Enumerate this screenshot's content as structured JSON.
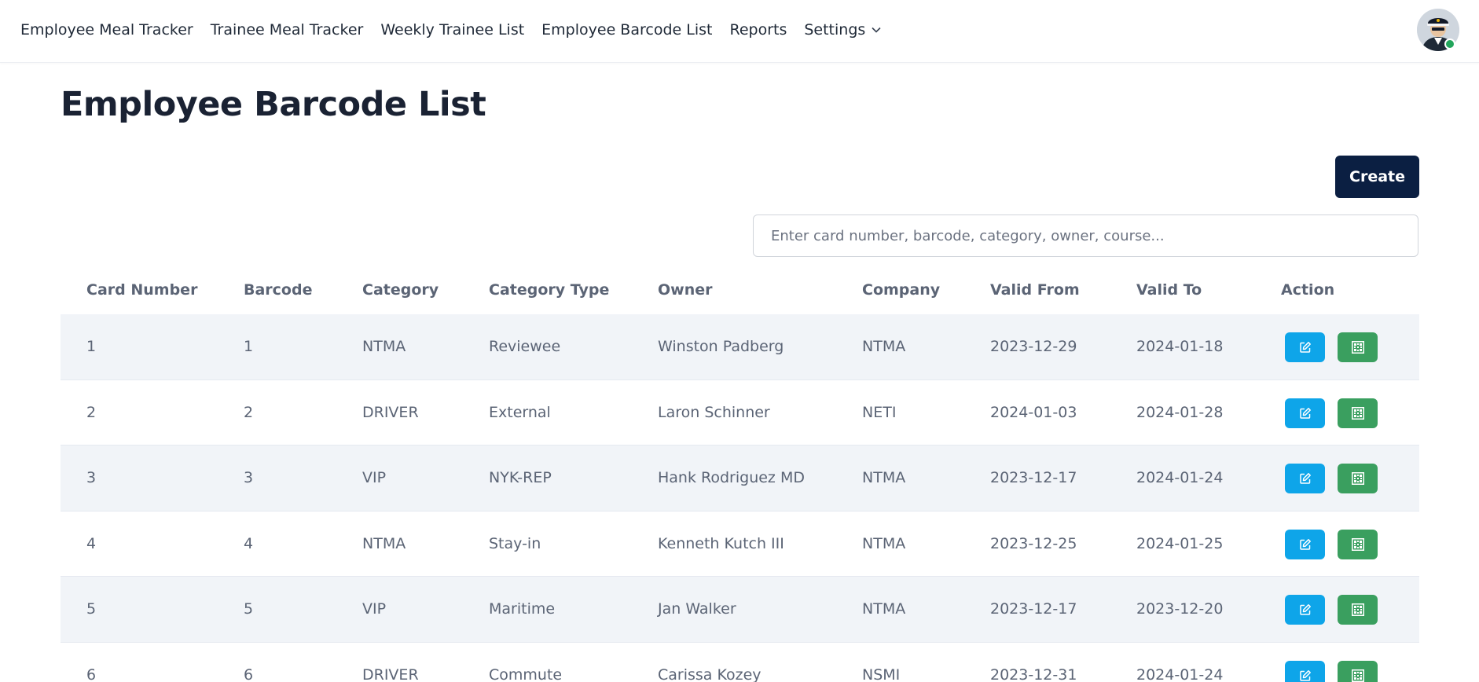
{
  "nav": {
    "items": [
      {
        "label": "Employee Meal Tracker"
      },
      {
        "label": "Trainee Meal Tracker"
      },
      {
        "label": "Weekly Trainee List"
      },
      {
        "label": "Employee Barcode List"
      },
      {
        "label": "Reports"
      }
    ],
    "settings_label": "Settings",
    "settings_icon": "chevron-down-icon",
    "avatar_icon": "user-avatar",
    "status_color": "#22a55b"
  },
  "page": {
    "title": "Employee Barcode List",
    "create_label": "Create",
    "search_placeholder": "Enter card number, barcode, category, owner, course...",
    "search_value": ""
  },
  "table": {
    "headers": [
      "Card Number",
      "Barcode",
      "Category",
      "Category Type",
      "Owner",
      "Company",
      "Valid From",
      "Valid To",
      "Action"
    ],
    "rows": [
      {
        "card_number": "1",
        "barcode": "1",
        "category": "NTMA",
        "category_type": "Reviewee",
        "owner": "Winston Padberg",
        "company": "NTMA",
        "valid_from": "2023-12-29",
        "valid_to": "2024-01-18"
      },
      {
        "card_number": "2",
        "barcode": "2",
        "category": "DRIVER",
        "category_type": "External",
        "owner": "Laron Schinner",
        "company": "NETI",
        "valid_from": "2024-01-03",
        "valid_to": "2024-01-28"
      },
      {
        "card_number": "3",
        "barcode": "3",
        "category": "VIP",
        "category_type": "NYK-REP",
        "owner": "Hank Rodriguez MD",
        "company": "NTMA",
        "valid_from": "2023-12-17",
        "valid_to": "2024-01-24"
      },
      {
        "card_number": "4",
        "barcode": "4",
        "category": "NTMA",
        "category_type": "Stay-in",
        "owner": "Kenneth Kutch III",
        "company": "NTMA",
        "valid_from": "2023-12-25",
        "valid_to": "2024-01-25"
      },
      {
        "card_number": "5",
        "barcode": "5",
        "category": "VIP",
        "category_type": "Maritime",
        "owner": "Jan Walker",
        "company": "NTMA",
        "valid_from": "2023-12-17",
        "valid_to": "2023-12-20"
      },
      {
        "card_number": "6",
        "barcode": "6",
        "category": "DRIVER",
        "category_type": "Commute",
        "owner": "Carissa Kozey",
        "company": "NSMI",
        "valid_from": "2023-12-31",
        "valid_to": "2024-01-24"
      }
    ],
    "actions": {
      "edit_icon": "edit-icon",
      "qr_icon": "qr-code-icon",
      "edit_color": "#0ea5e9",
      "qr_color": "#3a9f5f"
    }
  }
}
